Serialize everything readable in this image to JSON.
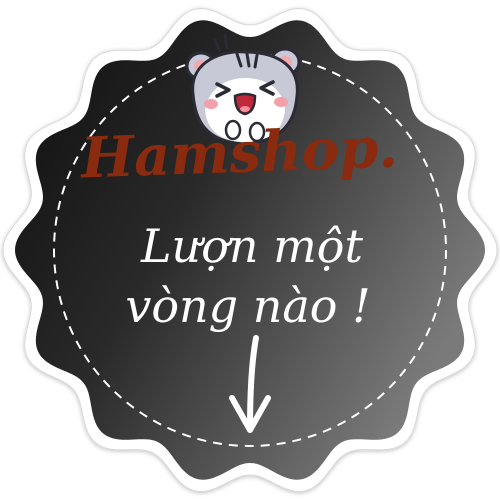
{
  "brand": {
    "name": "Hamshop.",
    "color": "#8a2a0e"
  },
  "message": {
    "line1": "Lượn một",
    "line2": "vòng nào !"
  },
  "badge": {
    "fill_dark": "#0d0d0d",
    "fill_light": "#7a7a7a",
    "border_color": "#ffffff",
    "dash_color": "#ffffff"
  },
  "icons": {
    "mascot": "hamster-mascot-icon",
    "arrow": "arrow-down-icon"
  }
}
